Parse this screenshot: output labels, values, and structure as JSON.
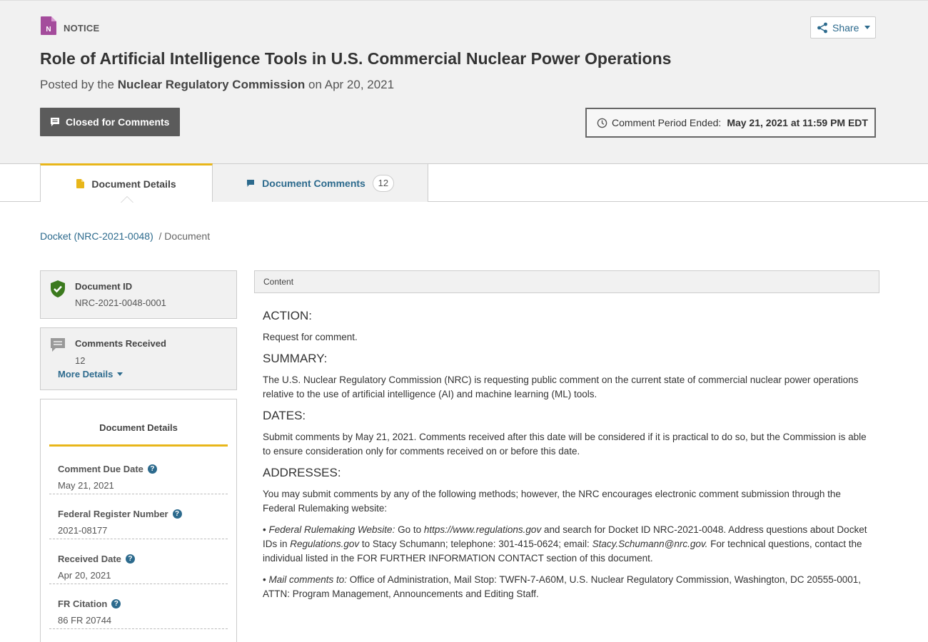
{
  "header": {
    "type_label": "NOTICE",
    "type_icon_letter": "N",
    "title": "Role of Artificial Intelligence Tools in U.S. Commercial Nuclear Power Operations",
    "posted_prefix": "Posted by the ",
    "agency": "Nuclear Regulatory Commission",
    "posted_on": " on Apr 20, 2021",
    "closed_button": "Closed for Comments",
    "share_button": "Share",
    "period_label": "Comment Period Ended:",
    "period_value": "May 21, 2021 at 11:59 PM EDT"
  },
  "tabs": {
    "details": "Document Details",
    "comments": "Document Comments",
    "comments_count": "12"
  },
  "breadcrumb": {
    "docket": "Docket (NRC-2021-0048)",
    "separator": "/",
    "current": "Document"
  },
  "sidebar": {
    "document_id_label": "Document ID",
    "document_id": "NRC-2021-0048-0001",
    "comments_received_label": "Comments Received",
    "comments_received": "12",
    "more_details": "More Details",
    "details_title": "Document Details",
    "fields": [
      {
        "label": "Comment Due Date",
        "value": "May 21, 2021"
      },
      {
        "label": "Federal Register Number",
        "value": "2021-08177"
      },
      {
        "label": "Received Date",
        "value": "Apr 20, 2021"
      },
      {
        "label": "FR Citation",
        "value": "86 FR 20744"
      }
    ],
    "help_glyph": "?"
  },
  "content": {
    "panel_label": "Content",
    "action_heading": "ACTION:",
    "action_text": "Request for comment.",
    "summary_heading": "SUMMARY:",
    "summary_text": "The U.S. Nuclear Regulatory Commission (NRC) is requesting public comment on the current state of commercial nuclear power operations relative to the use of artificial intelligence (AI) and machine learning (ML) tools.",
    "dates_heading": "DATES:",
    "dates_text": "Submit comments by May 21, 2021. Comments received after this date will be considered if it is practical to do so, but the Commission is able to ensure consideration only for comments received on or before this date.",
    "addresses_heading": "ADDRESSES:",
    "addresses_text": "You may submit comments by any of the following methods; however, the NRC encourages electronic comment submission through the Federal Rulemaking website:",
    "bullet1": {
      "mark": "• ",
      "lead": "Federal Rulemaking Website:",
      "t1": " Go to ",
      "url": "https://www.regulations.gov",
      "t2": " and search for Docket ID NRC-2021-0048. Address questions about Docket IDs in ",
      "site": "Regulations.gov",
      "t3": " to Stacy Schumann; telephone: 301-415-0624; email: ",
      "email": "Stacy.Schumann@nrc.gov.",
      "t4": " For technical questions, contact the individual listed in the FOR FURTHER INFORMATION CONTACT section of this document."
    },
    "bullet2": {
      "mark": "• ",
      "lead": "Mail comments to:",
      "text": " Office of Administration, Mail Stop: TWFN-7-A60M, U.S. Nuclear Regulatory Commission, Washington, DC 20555-0001, ATTN: Program Management, Announcements and Editing Staff."
    }
  }
}
